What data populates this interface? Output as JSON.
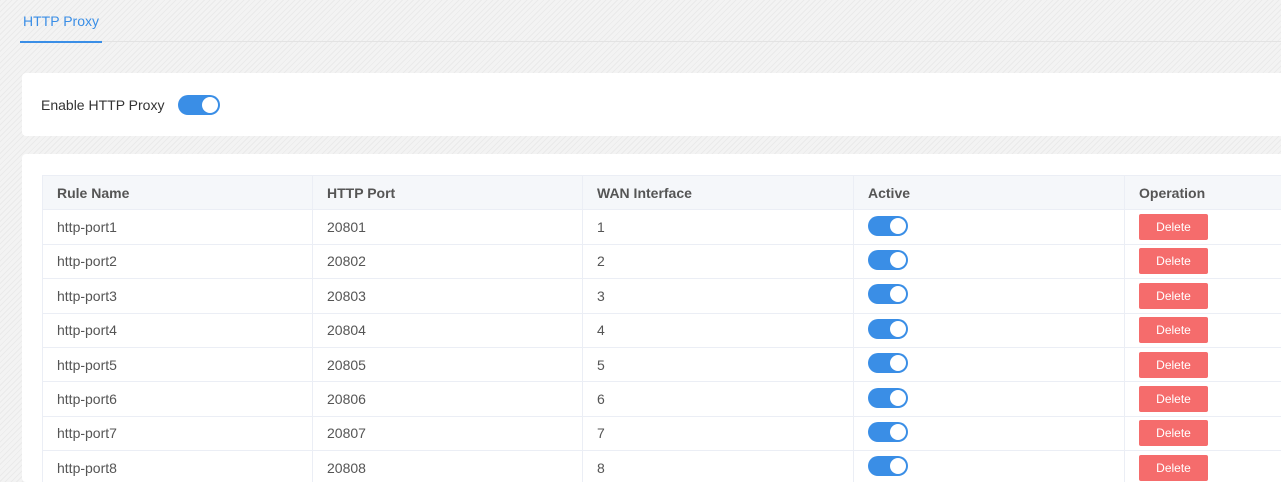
{
  "tabs": [
    {
      "label": "HTTP Proxy",
      "active": true
    }
  ],
  "enable": {
    "label": "Enable HTTP Proxy",
    "on": true
  },
  "table": {
    "headers": [
      "Rule Name",
      "HTTP Port",
      "WAN Interface",
      "Active",
      "Operation"
    ],
    "delete_label": "Delete",
    "rows": [
      {
        "name": "http-port1",
        "port": "20801",
        "wan": "1",
        "active": true
      },
      {
        "name": "http-port2",
        "port": "20802",
        "wan": "2",
        "active": true
      },
      {
        "name": "http-port3",
        "port": "20803",
        "wan": "3",
        "active": true
      },
      {
        "name": "http-port4",
        "port": "20804",
        "wan": "4",
        "active": true
      },
      {
        "name": "http-port5",
        "port": "20805",
        "wan": "5",
        "active": true
      },
      {
        "name": "http-port6",
        "port": "20806",
        "wan": "6",
        "active": true
      },
      {
        "name": "http-port7",
        "port": "20807",
        "wan": "7",
        "active": true
      },
      {
        "name": "http-port8",
        "port": "20808",
        "wan": "8",
        "active": true
      }
    ]
  },
  "colors": {
    "accent": "#3a8ee6",
    "danger": "#f56c6c"
  }
}
